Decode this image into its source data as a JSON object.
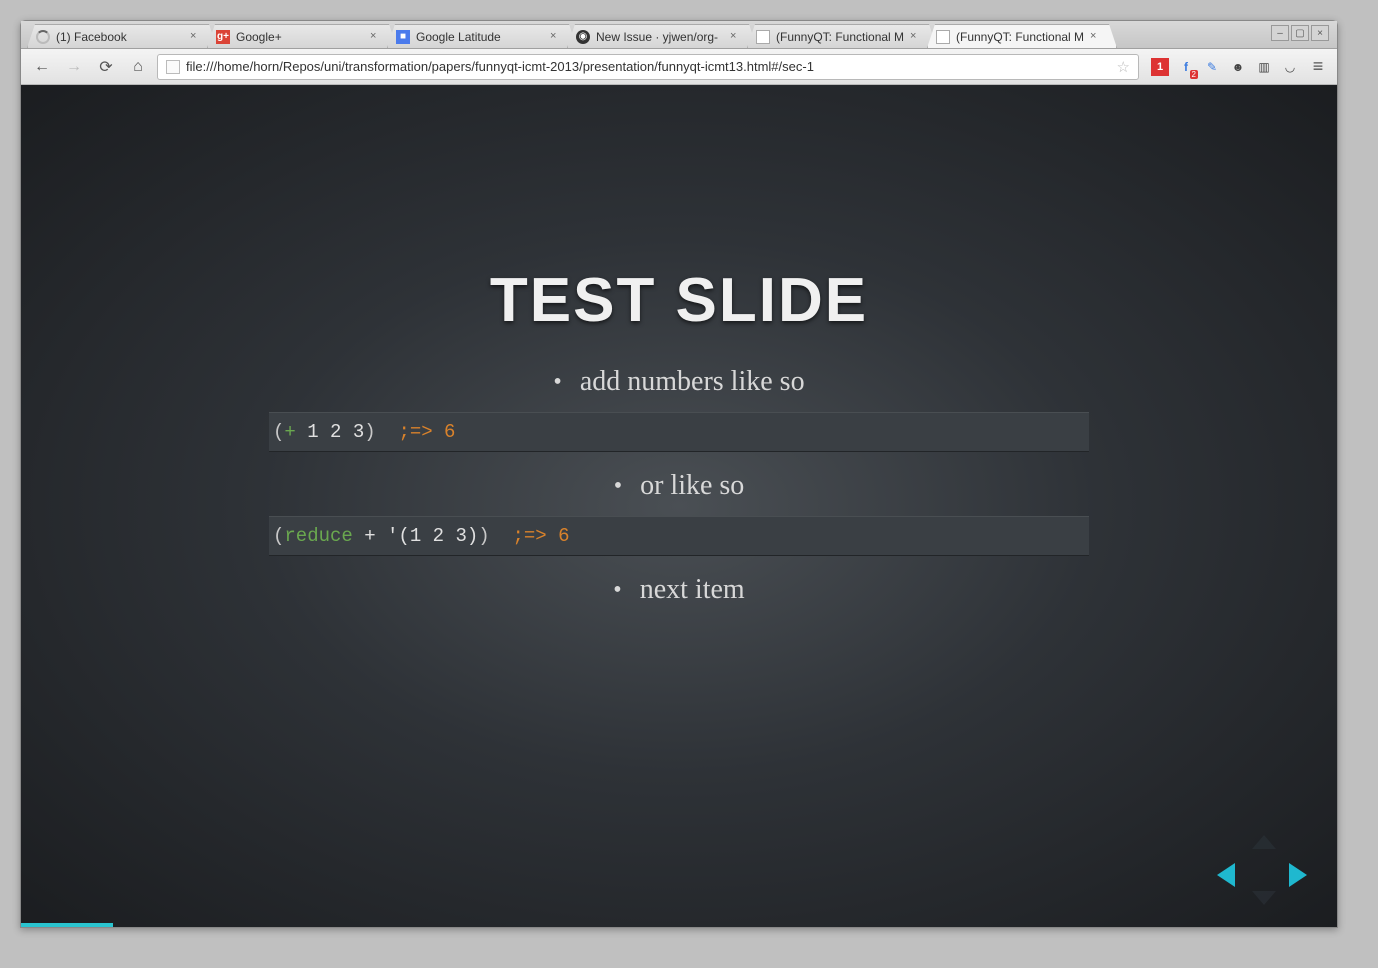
{
  "tabs": [
    {
      "label": "(1) Facebook",
      "icon": "spin"
    },
    {
      "label": "Google+",
      "icon": "gplus"
    },
    {
      "label": "Google Latitude",
      "icon": "blue"
    },
    {
      "label": "New Issue · yjwen/org-",
      "icon": "gh"
    },
    {
      "label": "(FunnyQT: Functional M",
      "icon": "doc"
    },
    {
      "label": "(FunnyQT: Functional M",
      "icon": "doc"
    }
  ],
  "active_tab_index": 5,
  "address": "file:///home/horn/Repos/uni/transformation/papers/funnyqt-icmt-2013/presentation/funnyqt-icmt13.html#/sec-1",
  "ext_red_badge": "1",
  "ext_f_badge": "2",
  "slide": {
    "title": "TEST SLIDE",
    "bullets": [
      "add numbers like so",
      "or like so",
      "next item"
    ],
    "code1": {
      "raw": "(+ 1 2 3)  ;=> 6",
      "paren1": "(",
      "op": "+",
      "mid": " 1 2 3",
      "paren2": ")",
      "sep": "  ",
      "comment": ";=> 6"
    },
    "code2": {
      "raw": "(reduce + '(1 2 3))  ;=> 6",
      "paren1": "(",
      "kw": "reduce",
      "mid": " + '(1 2 3)",
      "paren2": ")",
      "sep": "  ",
      "comment": ";=> 6"
    }
  }
}
